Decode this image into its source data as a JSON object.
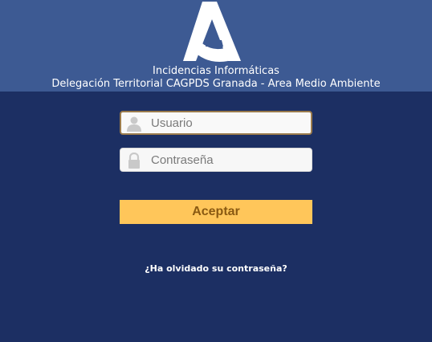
{
  "header": {
    "title_line1": "Incidencias Informáticas",
    "title_line2": "Delegación Territorial CAGPDS Granada - Area Medio Ambiente",
    "logo_icon": "junta-andalucia-logo-icon"
  },
  "login": {
    "username_placeholder": "Usuario",
    "username_value": "",
    "password_placeholder": "Contraseña",
    "password_value": "",
    "user_icon": "user-icon",
    "lock_icon": "lock-icon",
    "accept_label": "Aceptar",
    "forgot_label": "¿Ha olvidado su contraseña?"
  },
  "colors": {
    "header_bg": "#3d5a93",
    "page_bg": "#1c2f63",
    "accept_bg": "#ffc65a",
    "accept_text": "#8a5a12"
  }
}
